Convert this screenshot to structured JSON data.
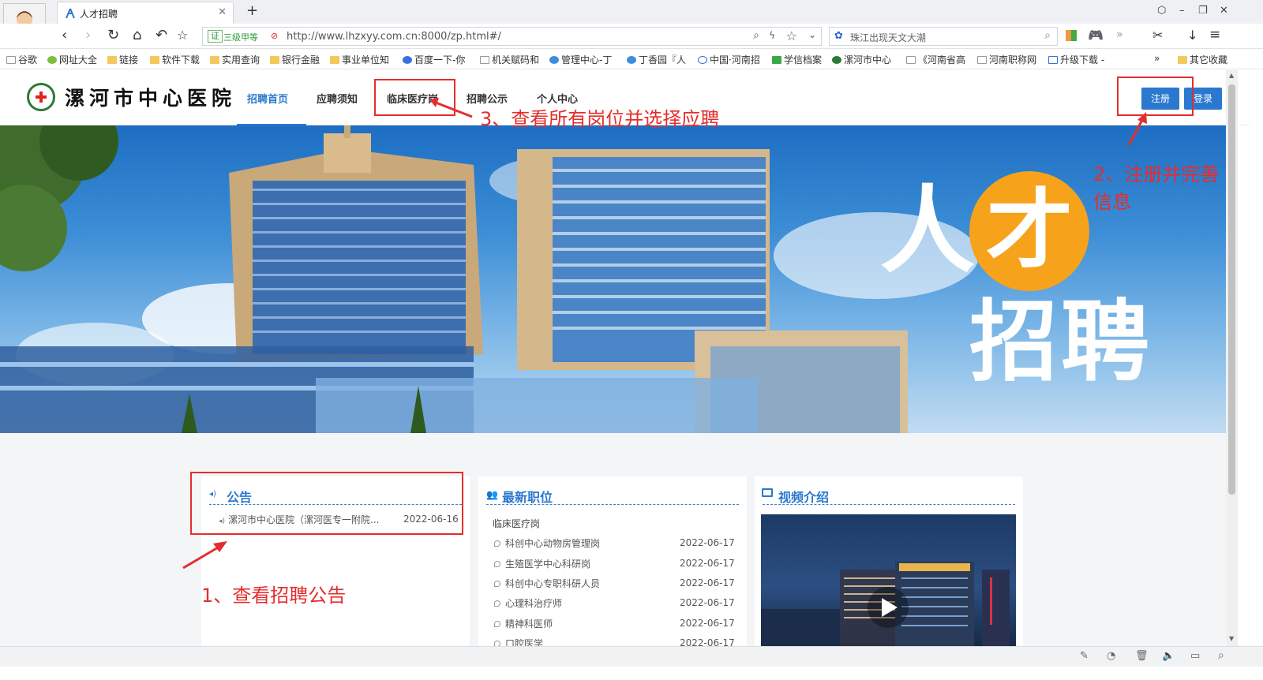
{
  "browser": {
    "tab_title": "人才招聘",
    "new_tab": "+",
    "url": "http://www.lhzxyy.com.cn:8000/zp.html#/",
    "cert_label": "三级甲等",
    "search_text": "珠江出现天文大潮",
    "window_controls": [
      "⬡",
      "–",
      "❐",
      "✕"
    ]
  },
  "bookmarks": [
    {
      "label": "谷歌"
    },
    {
      "label": "网址大全"
    },
    {
      "label": "链接"
    },
    {
      "label": "软件下载"
    },
    {
      "label": "实用查询"
    },
    {
      "label": "银行金融"
    },
    {
      "label": "事业单位知"
    },
    {
      "label": "百度一下-你"
    },
    {
      "label": "机关赋码和"
    },
    {
      "label": "管理中心-丁"
    },
    {
      "label": "丁香园『人"
    },
    {
      "label": "中国·河南招"
    },
    {
      "label": "学信档案"
    },
    {
      "label": "漯河市中心"
    },
    {
      "label": "《河南省高"
    },
    {
      "label": "河南职称网"
    },
    {
      "label": "升级下载 -"
    },
    {
      "label": "»"
    },
    {
      "label": "其它收藏"
    }
  ],
  "site": {
    "logo_text": "漯河市中心医院",
    "menu": [
      "招聘首页",
      "应聘须知",
      "临床医疗岗",
      "招聘公示",
      "个人中心"
    ],
    "register_label": "注册",
    "login_label": "登录"
  },
  "banner": {
    "line1_a": "人",
    "line1_b": "才",
    "line2": "招聘"
  },
  "notice": {
    "title": "公告",
    "items": [
      {
        "text": "漯河市中心医院（漯河医专一附院...",
        "date": "2022-06-16"
      }
    ]
  },
  "jobs": {
    "title": "最新职位",
    "category": "临床医疗岗",
    "items": [
      {
        "text": "科创中心动物房管理岗",
        "date": "2022-06-17"
      },
      {
        "text": "生殖医学中心科研岗",
        "date": "2022-06-17"
      },
      {
        "text": "科创中心专职科研人员",
        "date": "2022-06-17"
      },
      {
        "text": "心理科治疗师",
        "date": "2022-06-17"
      },
      {
        "text": "精神科医师",
        "date": "2022-06-17"
      },
      {
        "text": "口腔医学",
        "date": "2022-06-17"
      }
    ]
  },
  "video": {
    "title": "视频介绍"
  },
  "annotations": {
    "step1": "1、查看招聘公告",
    "step2_line1": "2、注册并完善",
    "step2_line2": "信息",
    "step3": "3、查看所有岗位并选择应聘"
  },
  "colors": {
    "accent": "#2b78d0",
    "annotation": "#e52d2d",
    "orange": "#f7a21b"
  }
}
